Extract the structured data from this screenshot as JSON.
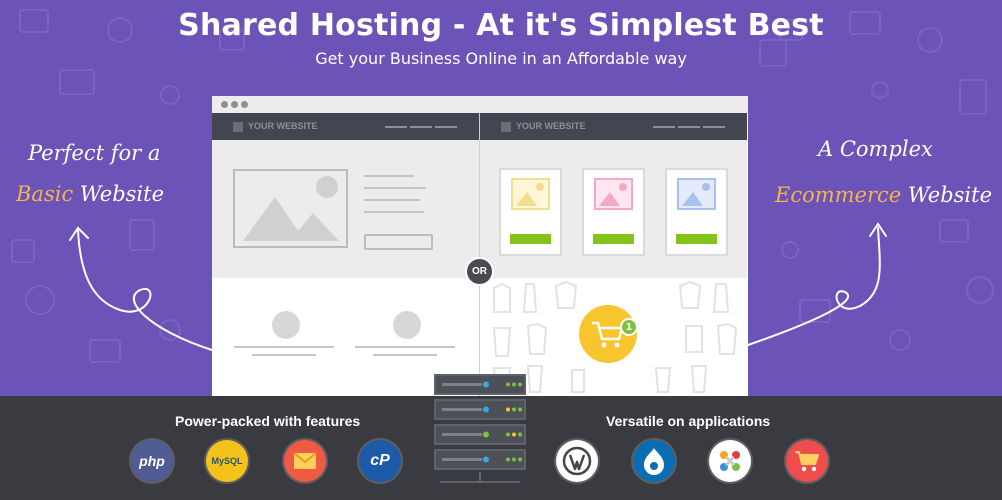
{
  "hero": {
    "title": "Shared Hosting - At it's Simplest Best",
    "subtitle": "Get your Business Online in an Affordable way"
  },
  "left_callout": {
    "line1": "Perfect for a",
    "highlight": "Basic",
    "line2_rest": " Website"
  },
  "right_callout": {
    "line1": "A Complex",
    "highlight": "Ecommerce",
    "line2_rest": " Website"
  },
  "mockup": {
    "left_pane_title": "YOUR WEBSITE",
    "right_pane_title": "YOUR WEBSITE",
    "or_label": "OR",
    "cart_count": "1"
  },
  "features": {
    "heading": "Power-packed with features",
    "items": [
      {
        "icon": "php-icon",
        "label": "php",
        "color": "#4f5b93"
      },
      {
        "icon": "mysql-icon",
        "label": "MySQL",
        "color": "#f3c21b"
      },
      {
        "icon": "email-icon",
        "label": "",
        "color": "#ef5a42"
      },
      {
        "icon": "cpanel-icon",
        "label": "cP",
        "color": "#1d5aa8"
      }
    ]
  },
  "applications": {
    "heading": "Versatile on applications",
    "items": [
      {
        "icon": "wordpress-icon",
        "color": "#ffffff"
      },
      {
        "icon": "drupal-icon",
        "color": "#0a6db3"
      },
      {
        "icon": "joomla-icon",
        "color": "#ffffff"
      },
      {
        "icon": "shopping-cart-icon",
        "color": "#ef4d4d"
      }
    ]
  },
  "colors": {
    "hero_background": "#6b53b8",
    "band_background": "#3a3b40",
    "accent_orange": "#f6b44e",
    "button_green": "#84c41a"
  }
}
